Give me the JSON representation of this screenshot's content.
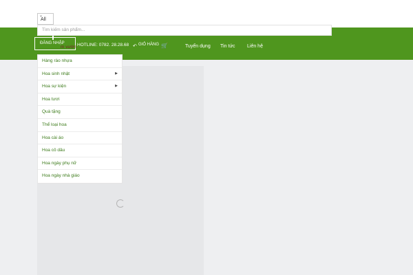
{
  "header": {
    "category_select": {
      "value": "All"
    },
    "search": {
      "placeholder": "Tìm kiếm sản phẩm..."
    }
  },
  "nav": {
    "login_label": "ĐĂNG NHẬP",
    "garden_fragment": "m vườn",
    "hotline": "HOTLINE: 0782. 28.28.68",
    "cart_label": "GIỎ HÀNG",
    "links": [
      "Tuyển dụng",
      "Tin tức",
      "Liên hệ"
    ]
  },
  "dropdown": {
    "items": [
      {
        "label": "Hàng rào nhựa",
        "has_submenu": false
      },
      {
        "label": "Hoa sinh nhật",
        "has_submenu": true
      },
      {
        "label": "Hoa sự kiện",
        "has_submenu": true
      },
      {
        "label": "Hoa tươi",
        "has_submenu": false
      },
      {
        "label": "Quà tặng",
        "has_submenu": false
      },
      {
        "label": "Thể loại hoa",
        "has_submenu": false
      },
      {
        "label": "Hoa cài áo",
        "has_submenu": false
      },
      {
        "label": "Hoa cô dâu",
        "has_submenu": false
      },
      {
        "label": "Hoa ngày phụ nữ",
        "has_submenu": false
      },
      {
        "label": "Hoa ngày nhà giáo",
        "has_submenu": false
      }
    ]
  },
  "icons": {
    "select_chevron": "chevron-down-icon",
    "cart": "cart-icon",
    "submenu": "caret-right-icon",
    "loading": "spinner-icon"
  },
  "colors": {
    "brand_green": "#4f961e",
    "link_green": "#3b7a19",
    "page_bg": "#eeeff1"
  }
}
